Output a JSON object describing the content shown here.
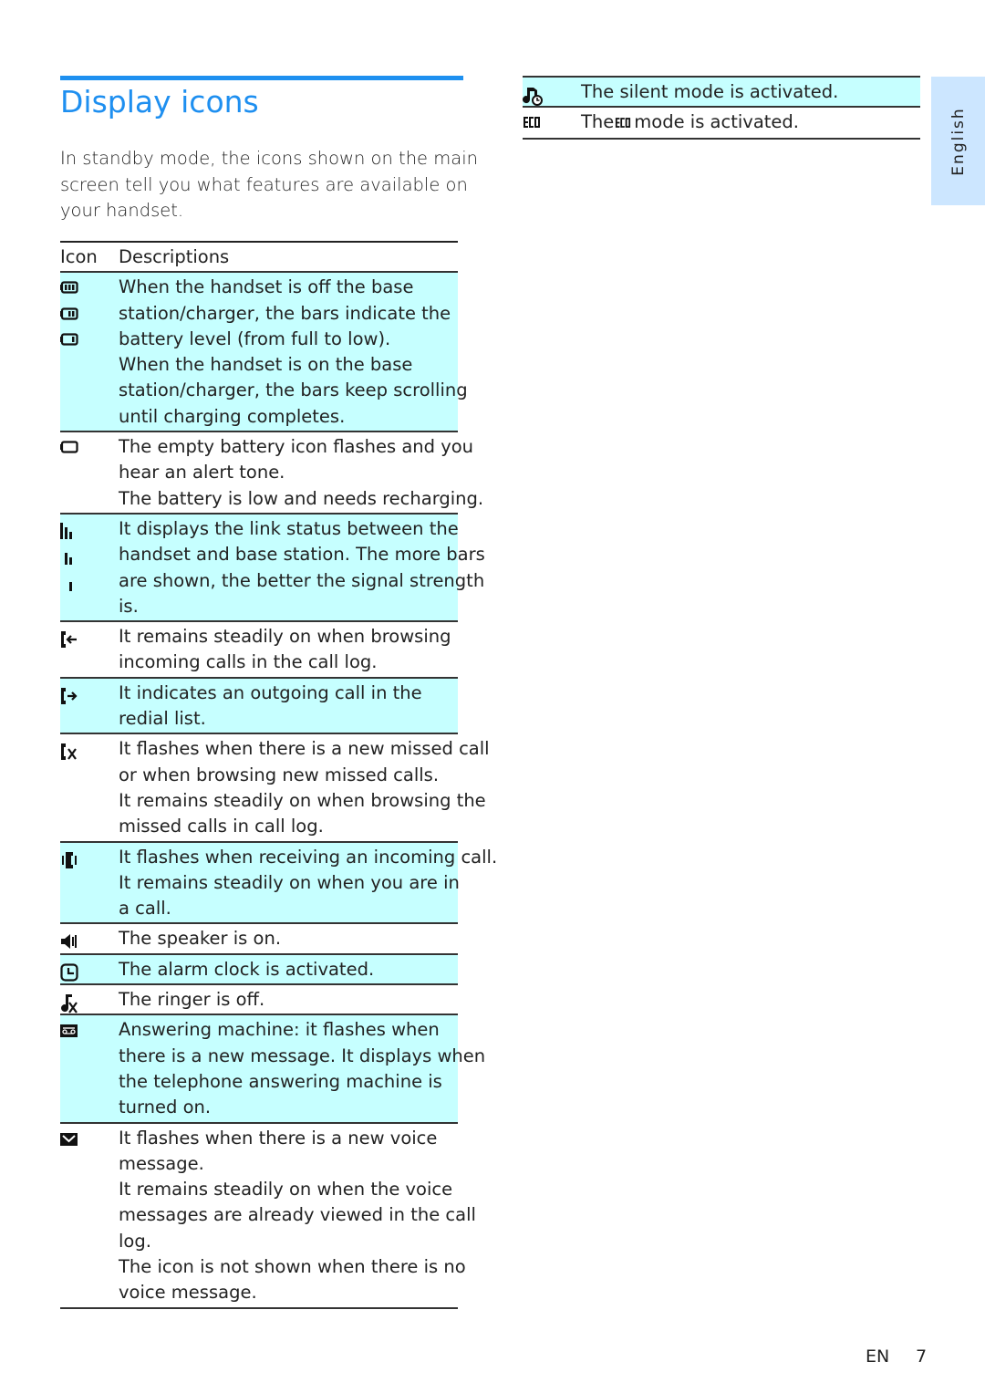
{
  "section": {
    "title": "Display icons",
    "intro": [
      "In standby mode, the icons shown on the main",
      "screen tell you what features are available on",
      "your handset."
    ]
  },
  "table": {
    "headers": {
      "icon": "Icon",
      "description": "Descriptions"
    },
    "shade_color": "#c6ffff",
    "rows": [
      {
        "icons": [
          "battery-full-icon",
          "battery-two-bars-icon",
          "battery-one-bar-icon"
        ],
        "shaded": true,
        "lines": [
          "When the handset is off the base",
          "station/charger, the bars indicate the",
          "battery level (from full to low).",
          "When the handset is on the base",
          "station/charger, the bars keep scrolling",
          "until charging completes."
        ]
      },
      {
        "icons": [
          "battery-empty-icon"
        ],
        "shaded": false,
        "lines": [
          "The empty battery icon flashes and you",
          "hear an alert tone.",
          "The battery is low and needs recharging."
        ]
      },
      {
        "icons": [
          "signal-full-icon",
          "signal-medium-icon",
          "signal-low-icon"
        ],
        "shaded": true,
        "lines": [
          "It displays the link status between the",
          "handset and base station. The more bars",
          "are shown, the better the signal strength",
          "is."
        ]
      },
      {
        "icons": [
          "incoming-call-icon"
        ],
        "shaded": false,
        "lines": [
          "It remains steadily on when browsing",
          "incoming calls in the call log."
        ]
      },
      {
        "icons": [
          "outgoing-call-icon"
        ],
        "shaded": true,
        "lines": [
          "It indicates an outgoing call in the",
          "redial list."
        ]
      },
      {
        "icons": [
          "missed-call-icon"
        ],
        "shaded": false,
        "lines": [
          "It flashes when there is a new missed call",
          "or when browsing new missed calls.",
          "It remains steadily on when browsing the",
          "missed calls in call log."
        ]
      },
      {
        "icons": [
          "ringing-call-icon"
        ],
        "shaded": true,
        "lines": [
          "It flashes when receiving an incoming call.",
          "It remains steadily on when you are in",
          "a call."
        ]
      },
      {
        "icons": [
          "speaker-icon"
        ],
        "shaded": false,
        "lines": [
          "The speaker is on."
        ]
      },
      {
        "icons": [
          "alarm-clock-icon"
        ],
        "shaded": true,
        "lines": [
          "The alarm clock is activated."
        ]
      },
      {
        "icons": [
          "ringer-off-icon"
        ],
        "shaded": false,
        "lines": [
          "The ringer is off."
        ]
      },
      {
        "icons": [
          "answering-machine-icon"
        ],
        "shaded": true,
        "lines": [
          "Answering machine: it flashes when",
          "there is a new message. It displays when",
          "the telephone answering machine is",
          "turned on."
        ]
      },
      {
        "icons": [
          "voice-message-icon"
        ],
        "shaded": false,
        "lines": [
          "It flashes when there is a new voice",
          "message.",
          "It remains steadily on when the voice",
          "messages are already viewed in the call",
          "log.",
          "The icon is not shown when there is no",
          "voice message."
        ]
      }
    ],
    "right_rows": [
      {
        "icons": [
          "silent-mode-icon"
        ],
        "shaded": true,
        "lines": [
          "The silent mode is activated."
        ]
      },
      {
        "icons": [
          "eco-icon"
        ],
        "shaded": false,
        "eco_before": "The",
        "eco_after": "mode is activated."
      }
    ]
  },
  "side_tab": {
    "label": "English",
    "color": "#cce6ff"
  },
  "footer": {
    "lang": "EN",
    "page": "7"
  },
  "accent_color": "#1e8ff0"
}
